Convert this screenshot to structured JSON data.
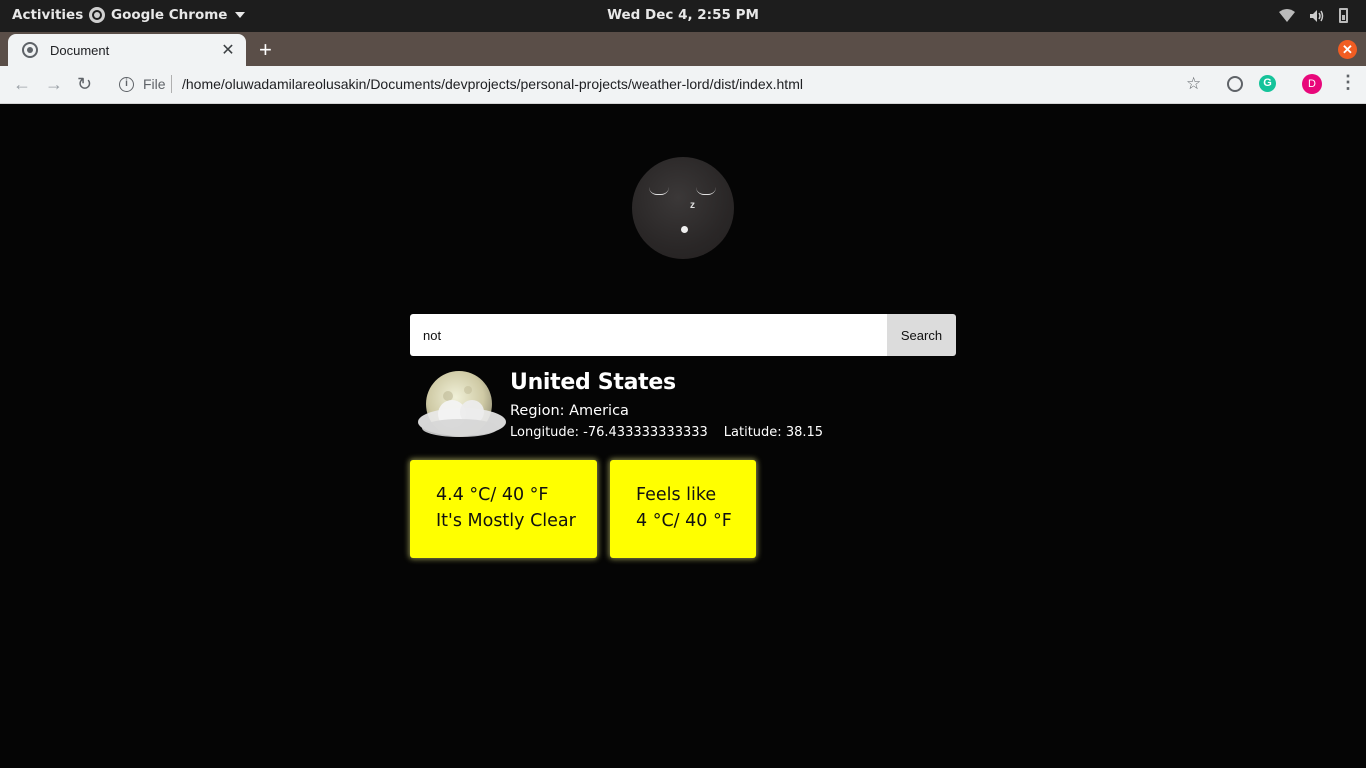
{
  "system_bar": {
    "activities": "Activities",
    "app_name": "Google Chrome",
    "clock": "Wed Dec  4,  2:55 PM"
  },
  "browser": {
    "tab_title": "Document",
    "tab_close": "✕",
    "new_tab": "+",
    "window_close": "✕",
    "back": "←",
    "forward": "→",
    "reload": "↻",
    "info": "i",
    "file_label": "File",
    "url": "/home/oluwadamilareolusakin/Documents/devprojects/personal-projects/weather-lord/dist/index.html",
    "star": "☆",
    "ext_grammarly": "G",
    "avatar_letter": "D",
    "menu": "⋮"
  },
  "moon": {
    "zzz": "z"
  },
  "search": {
    "value": "not",
    "button_label": "Search"
  },
  "location": {
    "country": "United States",
    "region": "Region: America",
    "longitude": "Longitude: -76.433333333333",
    "latitude": "Latitude: 38.15"
  },
  "cards": {
    "temperature": "4.4 °C/ 40 °F",
    "condition": "It's Mostly Clear",
    "feels_label": "Feels like",
    "feels_value": "4 °C/ 40 °F"
  },
  "colors": {
    "card": "#ffff00",
    "page_background": "#050505",
    "tab_strip": "#5a4e48"
  }
}
